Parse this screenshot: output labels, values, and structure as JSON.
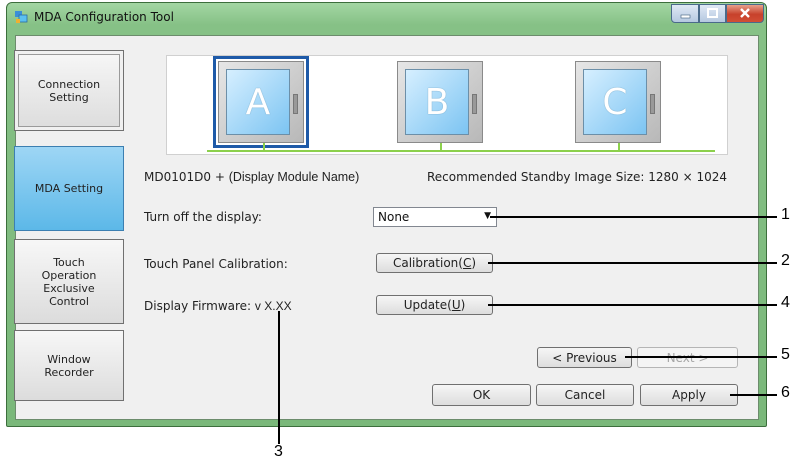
{
  "window": {
    "title": "MDA Configuration Tool"
  },
  "sidebar": {
    "items": [
      {
        "label": "Connection\nSetting"
      },
      {
        "label": "MDA Setting"
      },
      {
        "label": "Touch\nOperation\nExclusive\nControl"
      },
      {
        "label": "Window\nRecorder"
      }
    ]
  },
  "preview": {
    "monitors": [
      "A",
      "B",
      "C"
    ],
    "selected": "A"
  },
  "info": {
    "module_id": "MD0101D0 + ",
    "module_name": "(Display Module Name)",
    "recommended_size": "Recommended Standby Image Size: 1280 × 1024"
  },
  "settings": {
    "turn_off_label": "Turn off the display:",
    "turn_off_value": "None",
    "calibration_label": "Touch Panel Calibration:",
    "calibration_button": {
      "text": "Calibration(",
      "key": "C",
      "end": ")"
    },
    "firmware_label": "Display Firmware: ",
    "firmware_version": "v X.XX",
    "update_button": {
      "text": "Update(",
      "key": "U",
      "end": ")"
    }
  },
  "footer": {
    "previous": "< Previous",
    "next": "Next >",
    "ok": "OK",
    "cancel": "Cancel",
    "apply": "Apply"
  },
  "callouts": [
    "1",
    "2",
    "4",
    "5",
    "6",
    "3"
  ],
  "colors": {
    "selected_nav": "#5cb8e8",
    "frame_green": "#86c186",
    "selected_monitor_border": "#1e5aa8",
    "connector_green": "#8cd04c"
  }
}
